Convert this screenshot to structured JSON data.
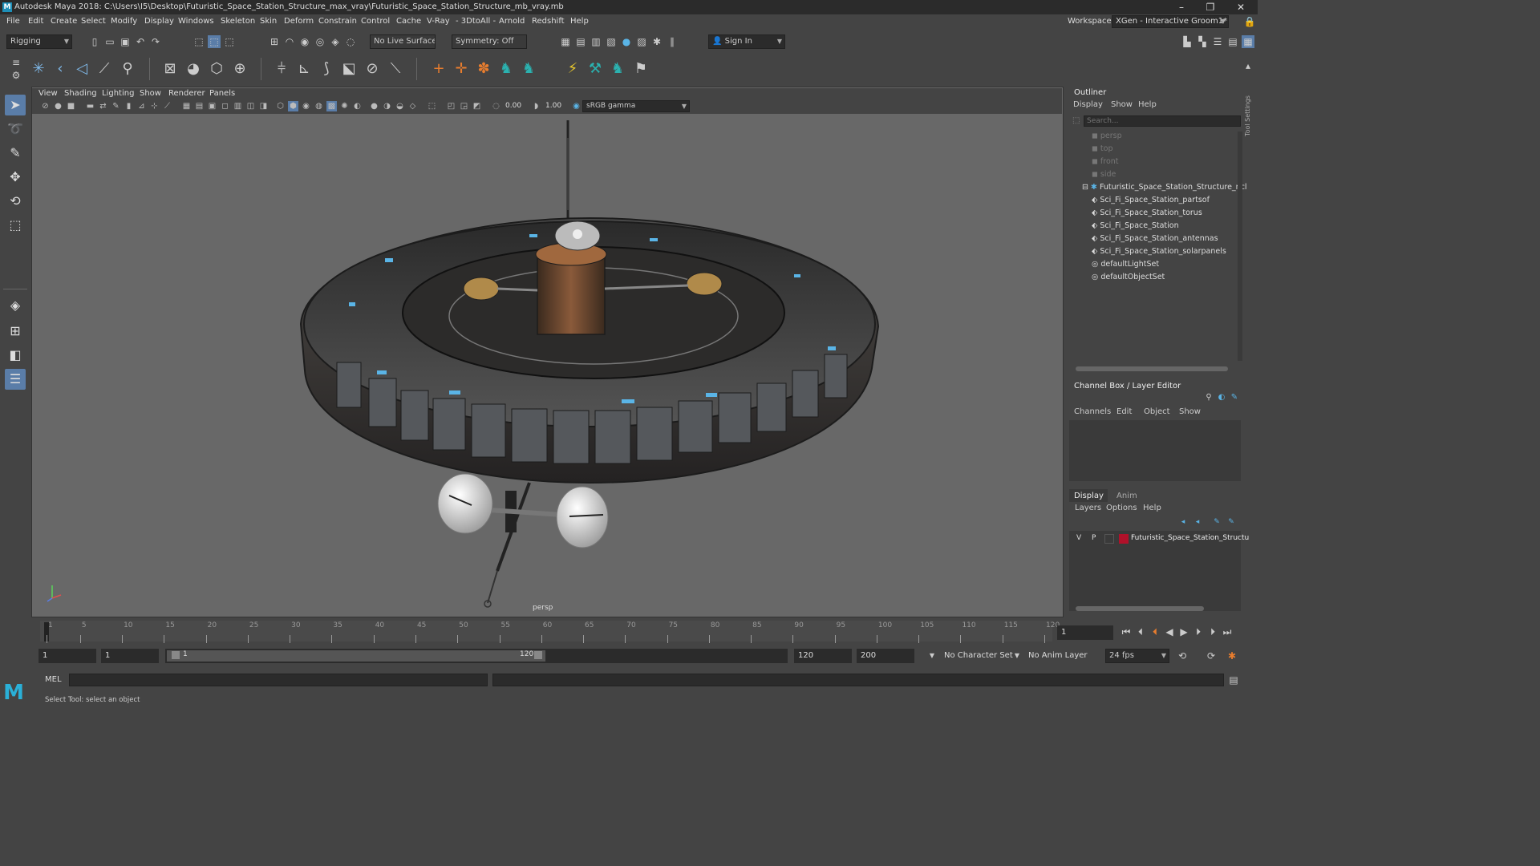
{
  "app": {
    "logo": "M",
    "title": "Autodesk Maya 2018: C:\\Users\\I5\\Desktop\\Futuristic_Space_Station_Structure_max_vray\\Futuristic_Space_Station_Structure_mb_vray.mb",
    "window_controls": {
      "minimize": "–",
      "maximize": "❐",
      "close": "✕"
    }
  },
  "menus": [
    "File",
    "Edit",
    "Create",
    "Select",
    "Modify",
    "Display",
    "Windows",
    "Skeleton",
    "Skin",
    "Deform",
    "Constrain",
    "Control",
    "Cache",
    "V-Ray",
    "- 3DtoAll -",
    "Arnold",
    "Redshift",
    "Help"
  ],
  "workspace": {
    "label": "Workspace :",
    "value": "XGen - Interactive Groom1*"
  },
  "toolbar": {
    "mode": "Rigging",
    "live_surface": "No Live Surface",
    "symmetry": "Symmetry: Off",
    "sign_in": "Sign In"
  },
  "viewport": {
    "menus": [
      "View",
      "Shading",
      "Lighting",
      "Show",
      "Renderer",
      "Panels"
    ],
    "exposure": "0.00",
    "gamma": "1.00",
    "color_space": "sRGB gamma",
    "camera_label": "persp"
  },
  "outliner": {
    "title": "Outliner",
    "menus": [
      "Display",
      "Show",
      "Help"
    ],
    "search_placeholder": "Search...",
    "items": [
      {
        "label": "persp",
        "icon": "camera-icon",
        "dim": true
      },
      {
        "label": "top",
        "icon": "camera-icon",
        "dim": true
      },
      {
        "label": "front",
        "icon": "camera-icon",
        "dim": true
      },
      {
        "label": "side",
        "icon": "camera-icon",
        "dim": true
      },
      {
        "label": "Futuristic_Space_Station_Structure_ncl",
        "icon": "group-icon",
        "dim": false
      },
      {
        "label": "Sci_Fi_Space_Station_partsof",
        "icon": "mesh-icon",
        "dim": false
      },
      {
        "label": "Sci_Fi_Space_Station_torus",
        "icon": "mesh-icon",
        "dim": false
      },
      {
        "label": "Sci_Fi_Space_Station",
        "icon": "mesh-icon",
        "dim": false
      },
      {
        "label": "Sci_Fi_Space_Station_antennas",
        "icon": "mesh-icon",
        "dim": false
      },
      {
        "label": "Sci_Fi_Space_Station_solarpanels",
        "icon": "mesh-icon",
        "dim": false
      },
      {
        "label": "defaultLightSet",
        "icon": "set-icon",
        "dim": false
      },
      {
        "label": "defaultObjectSet",
        "icon": "set-icon",
        "dim": false
      }
    ]
  },
  "channel_box": {
    "title": "Channel Box / Layer Editor",
    "menus": [
      "Channels",
      "Edit",
      "Object",
      "Show"
    ]
  },
  "layer_editor": {
    "tabs": [
      "Display",
      "Anim"
    ],
    "menus": [
      "Layers",
      "Options",
      "Help"
    ],
    "layer": {
      "v": "V",
      "p": "P",
      "name": "Futuristic_Space_Station_Structu",
      "color": "#b0112a"
    }
  },
  "side_tab": "Tool Settings",
  "timeline": {
    "ticks": [
      "1",
      "5",
      "10",
      "15",
      "20",
      "25",
      "30",
      "35",
      "40",
      "45",
      "50",
      "55",
      "60",
      "65",
      "70",
      "75",
      "80",
      "85",
      "90",
      "95",
      "100",
      "105",
      "110",
      "115",
      "120"
    ],
    "current_frame": "1"
  },
  "range": {
    "start": "1",
    "playback_start": "1",
    "slider_start": "1",
    "slider_end": "120",
    "playback_end": "120",
    "end": "200",
    "character_set": "No Character Set",
    "anim_layer": "No Anim Layer",
    "fps": "24 fps"
  },
  "command": {
    "lang": "MEL",
    "help_line": "Select Tool: select an object"
  },
  "colors": {
    "accent": "#5ab4e6",
    "layer": "#b0112a"
  }
}
